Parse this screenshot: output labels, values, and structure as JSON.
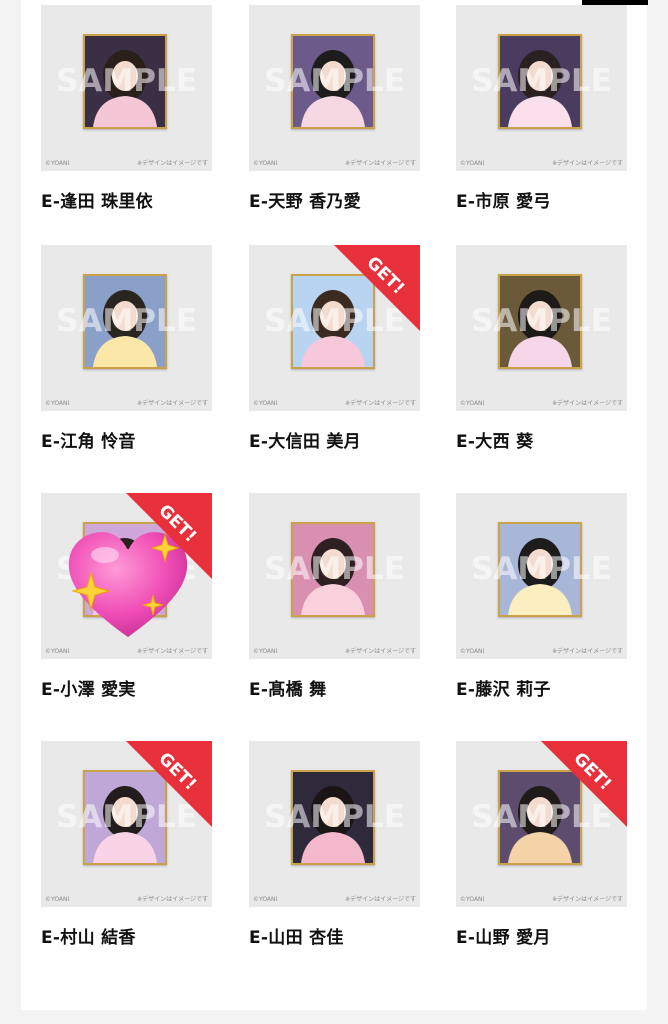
{
  "watermark": "SAMPLE",
  "copyright": "©YOANI",
  "design_note": "※デザインはイメージです",
  "badge_label": "GET!",
  "colors": {
    "badge": "#e8303a",
    "frame": "#c9a24a",
    "thumb_bg": "#e9e9e9"
  },
  "cards": [
    {
      "name": "E-逢田 珠里依",
      "get": false,
      "sticker": ""
    },
    {
      "name": "E-天野 香乃愛",
      "get": false,
      "sticker": ""
    },
    {
      "name": "E-市原 愛弓",
      "get": false,
      "sticker": ""
    },
    {
      "name": "E-江角 怜音",
      "get": false,
      "sticker": ""
    },
    {
      "name": "E-大信田 美月",
      "get": true,
      "sticker": ""
    },
    {
      "name": "E-大西 葵",
      "get": false,
      "sticker": ""
    },
    {
      "name": "E-小澤 愛実",
      "get": true,
      "sticker": "sparkling-heart-icon"
    },
    {
      "name": "E-髙橋 舞",
      "get": false,
      "sticker": ""
    },
    {
      "name": "E-藤沢 莉子",
      "get": false,
      "sticker": ""
    },
    {
      "name": "E-村山 結香",
      "get": true,
      "sticker": ""
    },
    {
      "name": "E-山田 杏佳",
      "get": false,
      "sticker": ""
    },
    {
      "name": "E-山野 愛月",
      "get": true,
      "sticker": ""
    }
  ]
}
